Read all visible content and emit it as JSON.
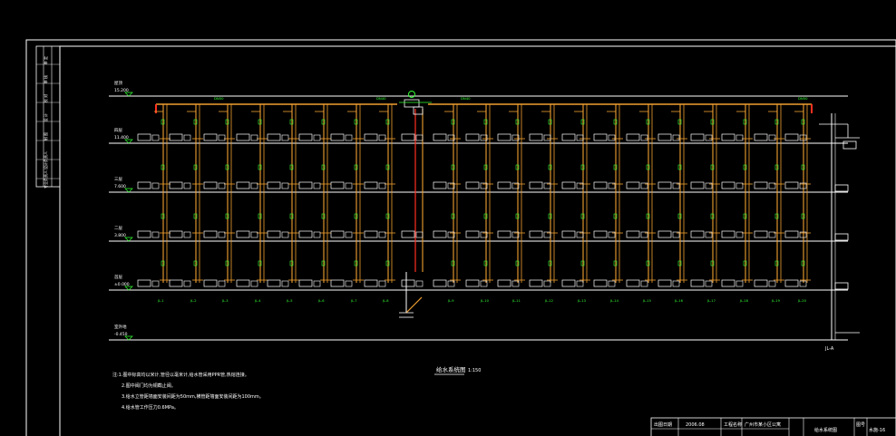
{
  "colors": {
    "background": "#000000",
    "border": "#ffffff",
    "pipe": "#f0a030",
    "riser_red": "#ff3020",
    "label_green": "#33ff33",
    "text_white": "#ffffff",
    "fixture": "#ffffff"
  },
  "floors": [
    {
      "name": "屋顶",
      "elevation": "15.200"
    },
    {
      "name": "四层",
      "elevation": "11.400"
    },
    {
      "name": "三层",
      "elevation": "7.600"
    },
    {
      "name": "二层",
      "elevation": "3.800"
    },
    {
      "name": "首层",
      "elevation": "±0.000"
    },
    {
      "name": "室外地",
      "elevation": "-0.450"
    }
  ],
  "roof_labels": [
    "DN50",
    "DN40",
    "DN40",
    "DN50"
  ],
  "riser_labels": [
    "JL-1",
    "JL-2",
    "JL-3",
    "JL-4",
    "JL-5",
    "JL-6",
    "JL-7",
    "JL-8",
    "JL-9",
    "JL-10",
    "JL-11",
    "JL-12",
    "JL-13",
    "JL-14",
    "JL-15",
    "JL-16",
    "JL-17",
    "JL-18",
    "JL-19",
    "JL-20"
  ],
  "drawing_title": "给水系统图",
  "drawing_scale": "1:150",
  "notes": [
    "注:1.图中标高均以米计,管径以毫米计,给水管采用PPR管,热熔连接。",
    "2.图中阀门均为铜截止阀。",
    "3.给水立管距墙面安装间距为50mm,横管距墙面安装间距为100mm。",
    "4.给水管工作压力0.6MPa。"
  ],
  "side_label": "JL-A",
  "left_stamp": [
    "审 定",
    "审 核",
    "校 对",
    "设 计",
    "制 图",
    "设计负责人",
    "专业负责人"
  ],
  "title_block": {
    "date_label": "出图日期",
    "date": "2006.08",
    "project_label": "工程名称",
    "project": "广州市某小区公寓",
    "drawing_name": "给水系统图",
    "sheet_label": "图号",
    "sheet_no": "水施-16"
  }
}
